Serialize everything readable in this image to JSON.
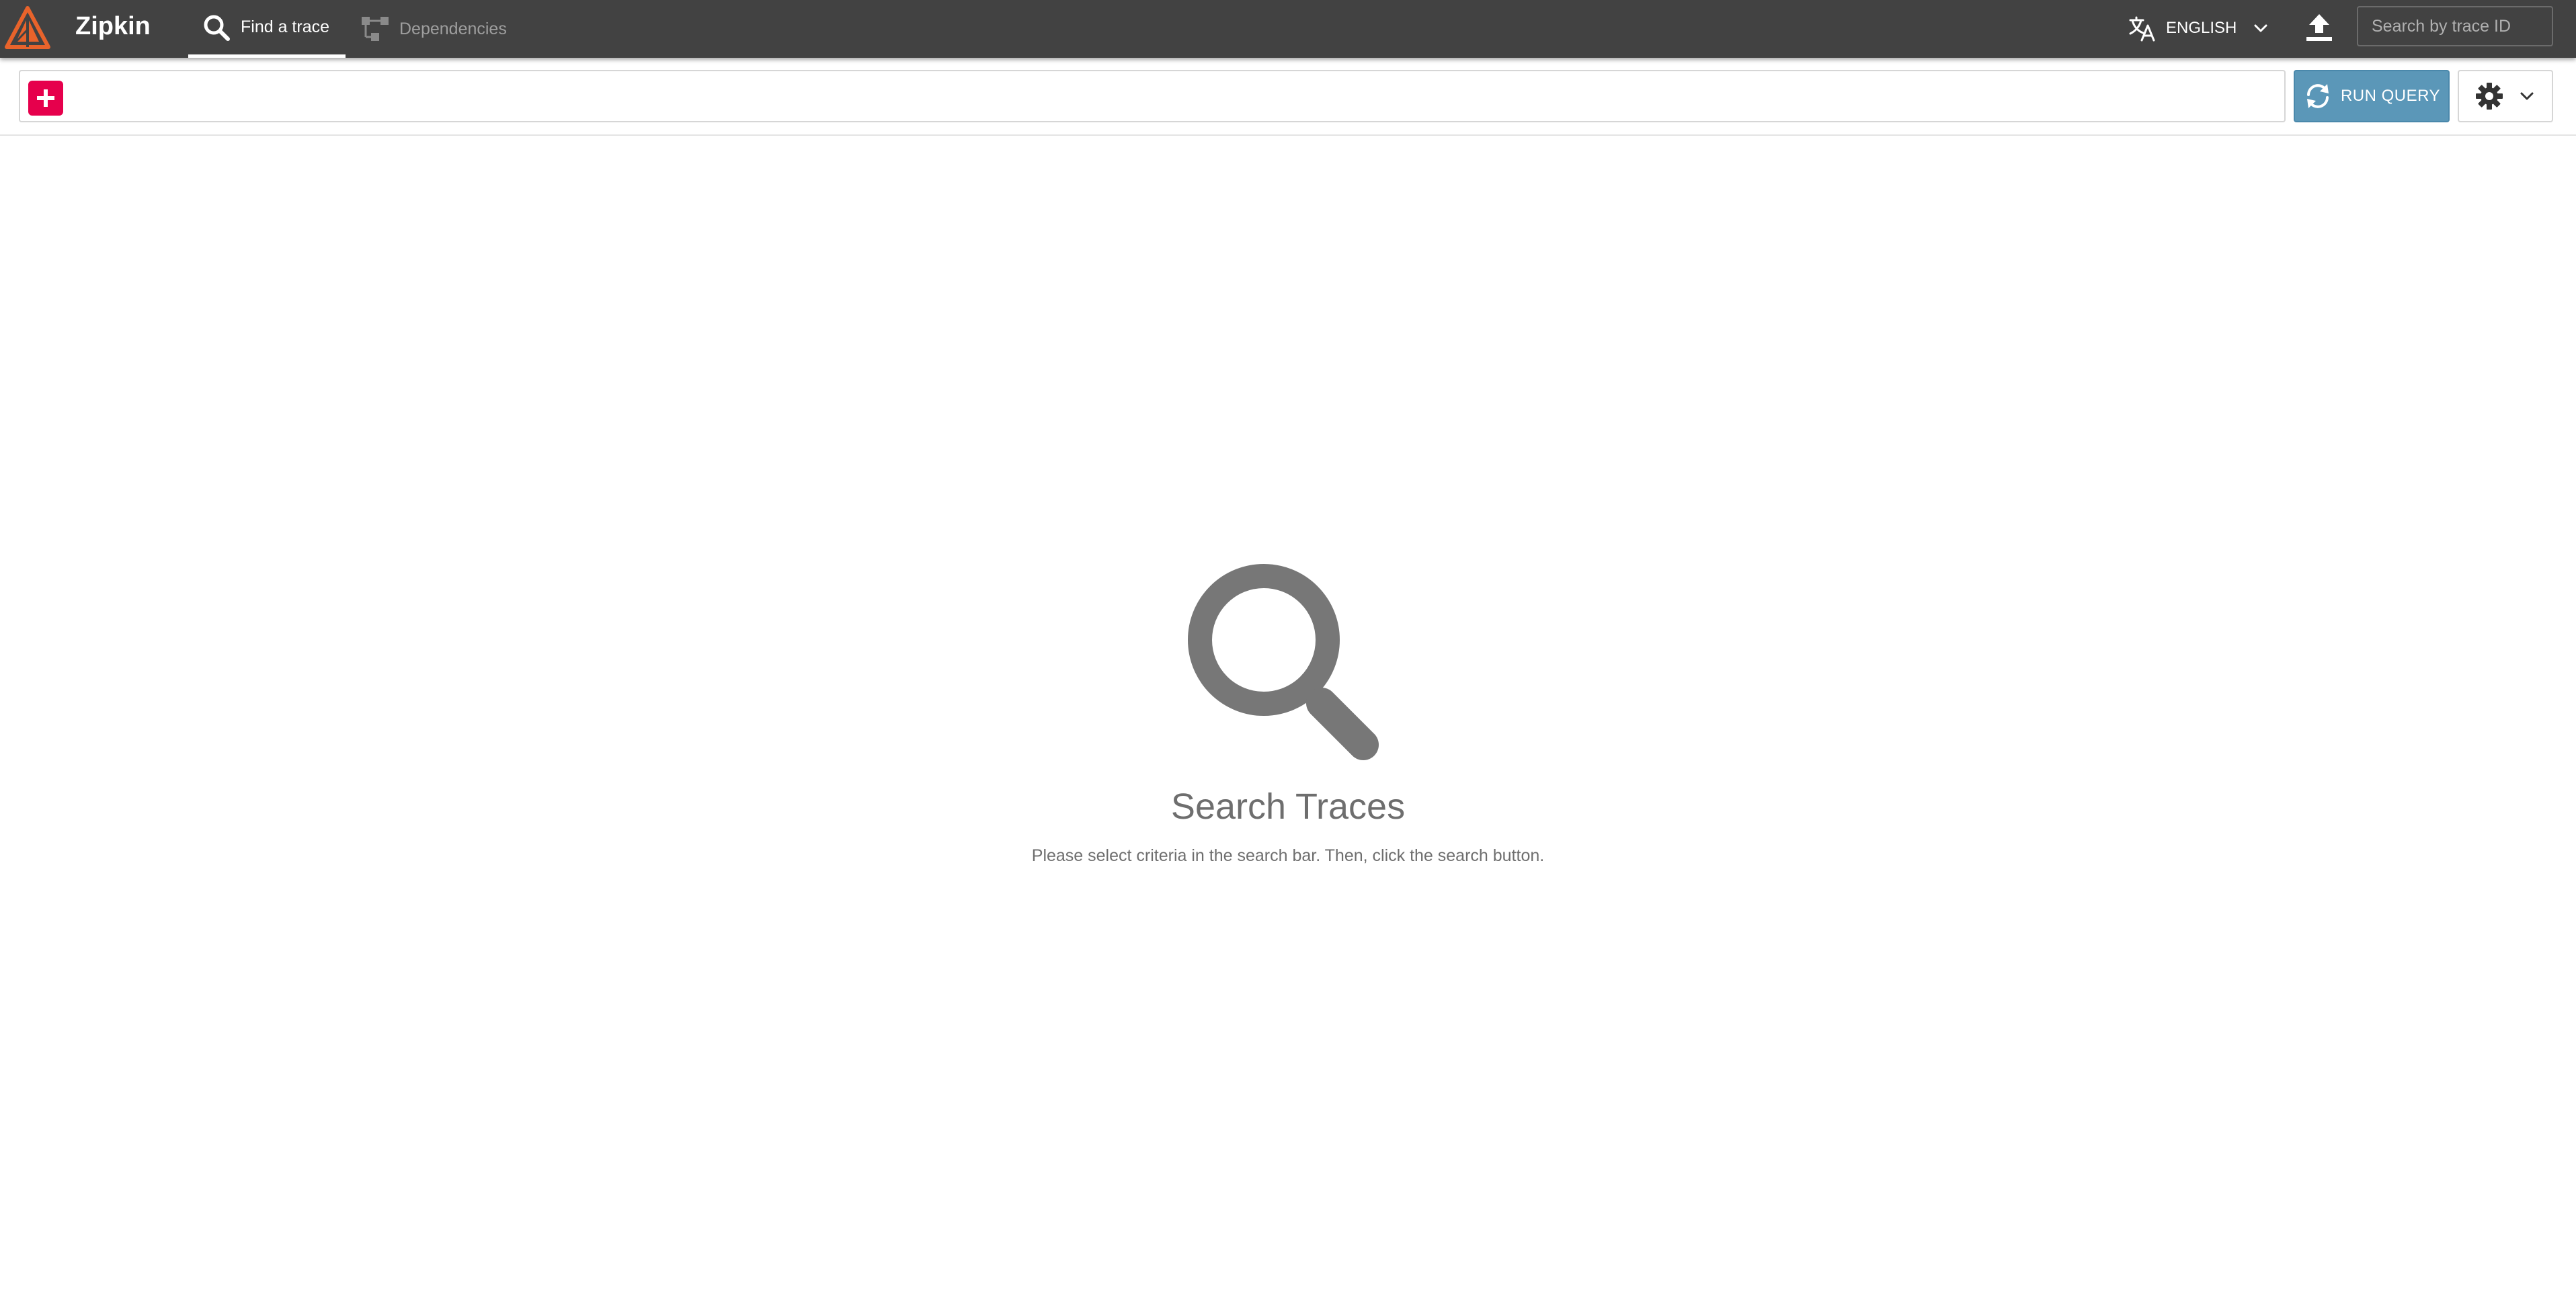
{
  "app": {
    "name": "Zipkin",
    "brand_color": "#e8632b"
  },
  "nav": {
    "tabs": [
      {
        "label": "Find a trace",
        "icon": "search-icon",
        "active": true
      },
      {
        "label": "Dependencies",
        "icon": "dependency-graph-icon",
        "active": false
      }
    ]
  },
  "header": {
    "language": {
      "label": "ENGLISH",
      "icon": "translate-icon"
    },
    "upload": {
      "icon": "upload-icon"
    },
    "trace_search": {
      "placeholder": "Search by trace ID",
      "value": ""
    }
  },
  "search_bar": {
    "add_criteria_icon": "plus-icon",
    "add_criteria_color": "#e6004c",
    "run_query_label": "RUN QUERY",
    "run_query_icon": "sync-icon",
    "run_query_color": "#5b97b8",
    "settings_icon": "gear-icon"
  },
  "empty_state": {
    "icon": "search-icon",
    "title": "Search Traces",
    "subtitle": "Please select criteria in the search bar. Then, click the search button."
  }
}
